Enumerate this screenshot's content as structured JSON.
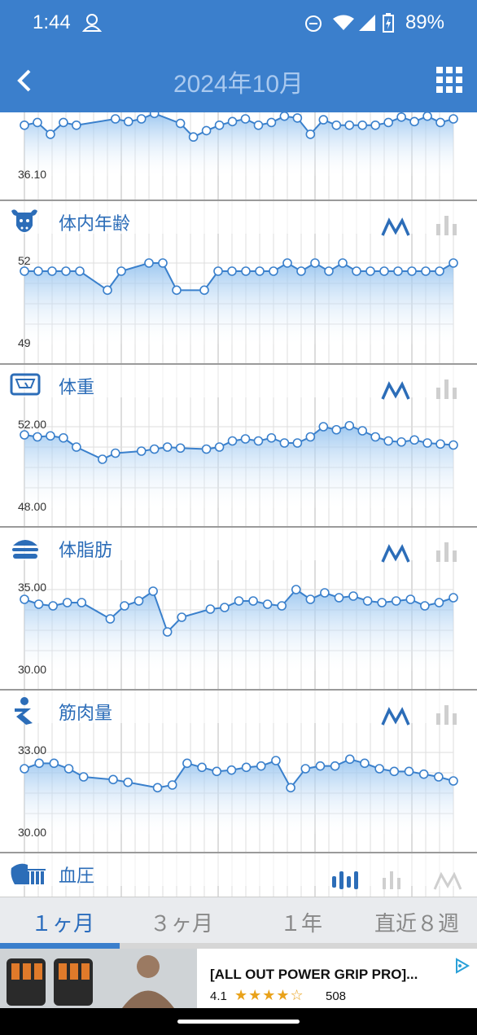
{
  "status": {
    "time": "1:44",
    "battery": "89%"
  },
  "appbar": {
    "title": "2024年10月"
  },
  "charts": [
    {
      "key": "temp",
      "icon": "thermometer-icon",
      "title": "",
      "ymax_label": "",
      "ymin_label": "36.10",
      "ymax": 37.0,
      "ymin": 36.1,
      "values": [
        36.66,
        36.69,
        36.56,
        36.69,
        36.66,
        null,
        null,
        36.73,
        36.7,
        36.73,
        36.79,
        null,
        36.68,
        36.53,
        36.6,
        36.66,
        36.7,
        36.73,
        36.66,
        36.69,
        36.76,
        36.74,
        36.56,
        36.72,
        36.66,
        36.66,
        36.66,
        36.66,
        36.69,
        36.75,
        36.7,
        36.76,
        36.69,
        36.73
      ]
    },
    {
      "key": "age",
      "icon": "cow-icon",
      "title": "体内年齢",
      "ymax_label": "52",
      "ymin_label": "49",
      "ymax": 52,
      "ymin": 49,
      "values": [
        51.7,
        51.7,
        51.7,
        51.7,
        51.7,
        null,
        51.0,
        51.7,
        null,
        52.0,
        52.0,
        51.0,
        null,
        51.0,
        51.7,
        51.7,
        51.7,
        51.7,
        51.7,
        52.0,
        51.7,
        52.0,
        51.7,
        52.0,
        51.7,
        51.7,
        51.7,
        51.7,
        51.7,
        51.7,
        51.7,
        52.0
      ]
    },
    {
      "key": "weight",
      "icon": "scale-icon",
      "title": "体重",
      "ymax_label": "52.00",
      "ymin_label": "48.00",
      "ymax": 52.0,
      "ymin": 48.0,
      "values": [
        51.6,
        51.5,
        51.55,
        51.45,
        51.0,
        null,
        50.4,
        50.7,
        null,
        50.8,
        50.9,
        51.0,
        50.95,
        null,
        50.9,
        51.0,
        51.3,
        51.4,
        51.3,
        51.45,
        51.2,
        51.2,
        51.5,
        52.0,
        51.85,
        52.05,
        51.8,
        51.5,
        51.3,
        51.25,
        51.35,
        51.2,
        51.15,
        51.1
      ]
    },
    {
      "key": "fat",
      "icon": "burger-icon",
      "title": "体脂肪",
      "ymax_label": "35.00",
      "ymin_label": "30.00",
      "ymax": 35.0,
      "ymin": 30.0,
      "values": [
        34.4,
        34.1,
        34.0,
        34.2,
        34.2,
        null,
        33.2,
        34.0,
        34.3,
        34.9,
        32.4,
        33.3,
        null,
        33.8,
        33.9,
        34.3,
        34.3,
        34.1,
        34.0,
        35.0,
        34.4,
        34.8,
        34.5,
        34.6,
        34.3,
        34.2,
        34.3,
        34.4,
        34.0,
        34.2,
        34.5
      ]
    },
    {
      "key": "muscle",
      "icon": "muscle-icon",
      "title": "筋肉量",
      "ymax_label": "33.00",
      "ymin_label": "30.00",
      "ymax": 33.0,
      "ymin": 30.0,
      "values": [
        32.4,
        32.6,
        32.6,
        32.4,
        32.1,
        null,
        32.0,
        31.9,
        null,
        31.7,
        31.8,
        32.6,
        32.45,
        32.3,
        32.35,
        32.45,
        32.5,
        32.7,
        31.7,
        32.4,
        32.5,
        32.5,
        32.75,
        32.6,
        32.4,
        32.3,
        32.3,
        32.2,
        32.1,
        31.95
      ]
    },
    {
      "key": "bp",
      "icon": "bp-icon",
      "title": "血圧",
      "ymax_label": "",
      "ymin_label": "",
      "ymax": 1,
      "ymin": 0,
      "values": []
    }
  ],
  "tabs": [
    {
      "label": "１ヶ月",
      "active": true
    },
    {
      "label": "３ヶ月",
      "active": false
    },
    {
      "label": "１年",
      "active": false
    },
    {
      "label": "直近８週",
      "active": false
    }
  ],
  "ad": {
    "title": "[ALL OUT POWER GRIP PRO]...",
    "rating": "4.1",
    "stars": "★★★★☆",
    "count": "508"
  },
  "colors": {
    "accent": "#3b7fcc",
    "line": "#3a80cc",
    "fill_top": "#8ebfee",
    "grid": "#cfcfcf"
  }
}
